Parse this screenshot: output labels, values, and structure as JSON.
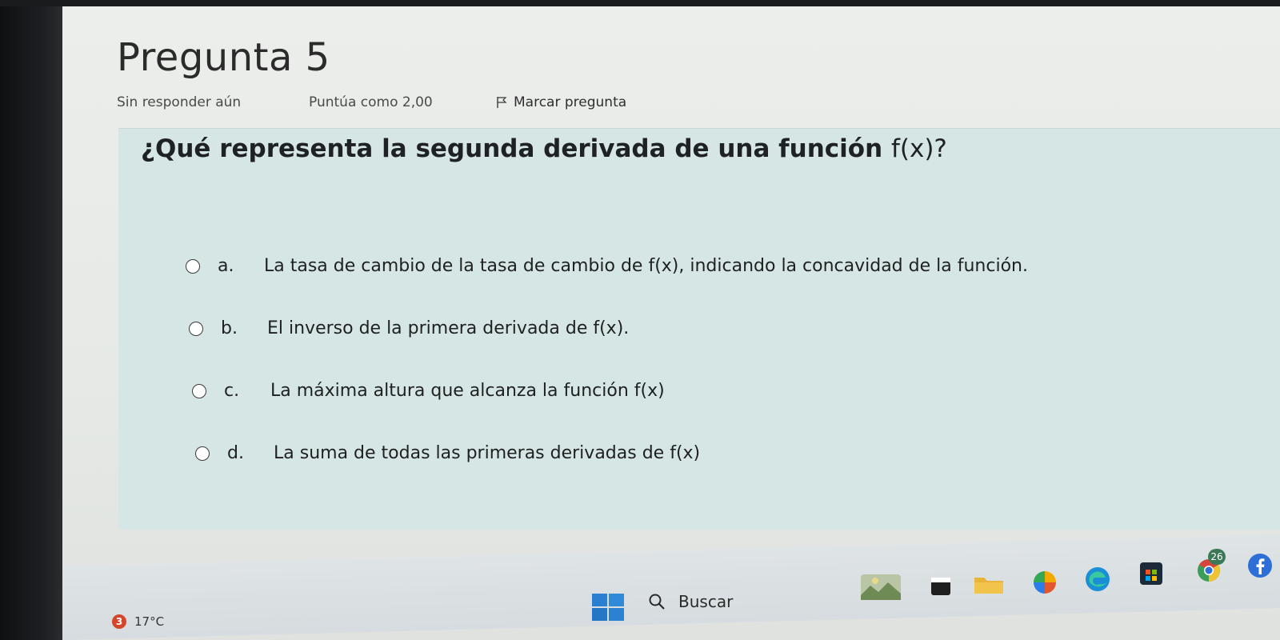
{
  "question": {
    "title": "Pregunta 5",
    "status": "Sin responder aún",
    "score": "Puntúa como 2,00",
    "flag_label": "Marcar pregunta",
    "text": "¿Qué representa la segunda derivada de una función",
    "text_fx": "f(x)?",
    "options": [
      {
        "letter": "a.",
        "text": "La tasa de cambio de la tasa de cambio de f(x), indicando la concavidad de la función."
      },
      {
        "letter": "b.",
        "text": "El inverso de la primera derivada de f(x)."
      },
      {
        "letter": "c.",
        "text": "La máxima altura que alcanza la función f(x)"
      },
      {
        "letter": "d.",
        "text": "La suma de todas las primeras derivadas de f(x)"
      }
    ]
  },
  "taskbar": {
    "weather_badge": "3",
    "weather_temp": "17°C",
    "search_label": "Buscar",
    "notification_badge": "26"
  },
  "colors": {
    "question_box": "#d6e6e4",
    "weather_badge": "#d4462b"
  },
  "icons": [
    "flag-icon",
    "windows-start-icon",
    "search-icon",
    "landscape-widget-icon",
    "app-icon",
    "folder-icon",
    "color-wheel-icon",
    "edge-browser-icon",
    "store-icon",
    "chrome-icon",
    "facebook-icon"
  ]
}
